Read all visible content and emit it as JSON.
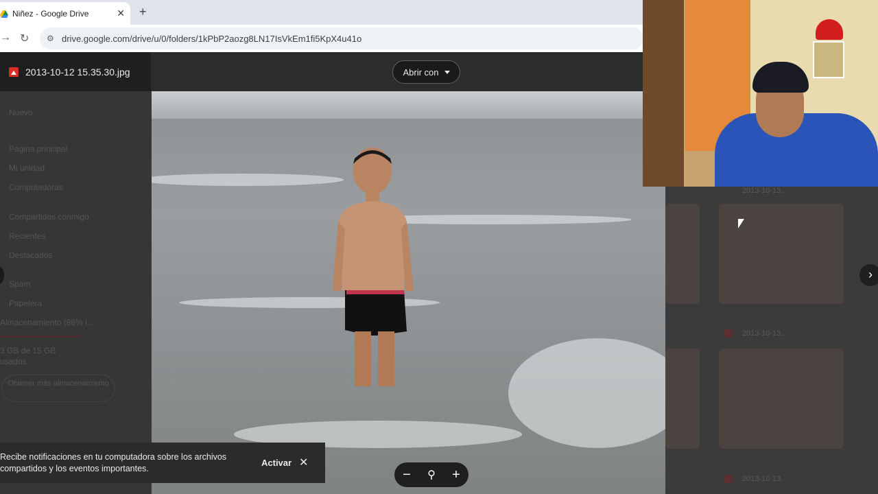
{
  "browser": {
    "tab_title": "Niñez - Google Drive",
    "close_glyph": "✕",
    "new_tab_glyph": "+",
    "url": "drive.google.com/drive/u/0/folders/1kPbP2aozg8LN17IsVkEm1fi5KpX4u41o"
  },
  "viewer": {
    "file_name": "2013-10-12 15.35.30.jpg",
    "open_with_label": "Abrir con",
    "zoom_out": "−",
    "zoom_icon": "🔍",
    "zoom_in": "+",
    "next_glyph": "›"
  },
  "sidebar": {
    "new_button": "Nuevo",
    "items": [
      "Página principal",
      "Mi unidad",
      "Computadoras",
      "Compartidos conmigo",
      "Recientes",
      "Destacados",
      "Spam",
      "Papelera",
      "Almacenamiento (86% l..."
    ],
    "storage_text": "3 GB de 15 GB",
    "storage_sub": "usados",
    "storage_button": "Obtener más almacenamiento"
  },
  "files": [
    "2013-10-13...",
    "2013-10-13...",
    "2013-10-13..."
  ],
  "toast": {
    "message": "Recibe notificaciones en tu computadora sobre los archivos compartidos y los eventos importantes.",
    "action": "Activar",
    "close": "✕"
  },
  "colors": {
    "accent_red": "#d93025",
    "overlay_bg": "#1f1f1f"
  }
}
